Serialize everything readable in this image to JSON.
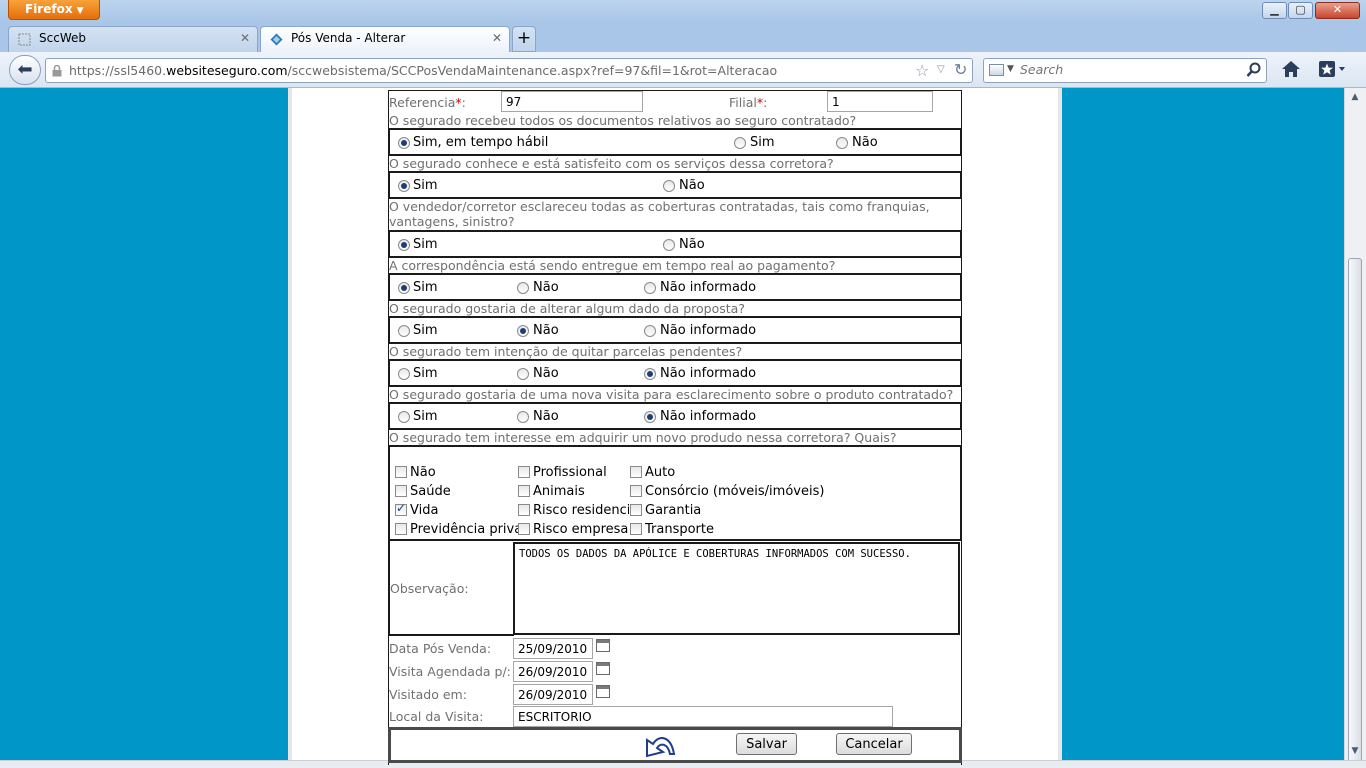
{
  "browser": {
    "app_button_label": "Firefox",
    "tabs": [
      {
        "label": "SccWeb"
      },
      {
        "label": "Pós Venda - Alterar"
      }
    ],
    "new_tab_label": "+",
    "url_prefix": "https://ssl5460.",
    "url_domain": "websiteseguro.com",
    "url_suffix": "/sccwebsistema/SCCPosVendaMaintenance.aspx?ref=97&fil=1&rot=Alteracao",
    "search_placeholder": "Search"
  },
  "form": {
    "referencia_label": "Referencia",
    "referencia_value": "97",
    "filial_label": "Filial",
    "filial_value": "1",
    "required_mark": "*",
    "colon": ":",
    "questions": [
      {
        "text": "O segurado recebeu todos os documentos relativos ao seguro contratado?",
        "options": [
          "Sim, em tempo hábil",
          "Sim",
          "Não"
        ]
      },
      {
        "text": "O segurado conhece e está satisfeito com os serviços dessa corretora?",
        "options": [
          "Sim",
          "Não"
        ]
      },
      {
        "text": "O vendedor/corretor esclareceu todas as coberturas contratadas, tais como franquias, vantagens, sinistro?",
        "options": [
          "Sim",
          "Não"
        ]
      },
      {
        "text": "A correspondência está sendo entregue em tempo real ao pagamento?",
        "options": [
          "Sim",
          "Não",
          "Não informado"
        ]
      },
      {
        "text": "O segurado gostaria de alterar algum dado da proposta?",
        "options": [
          "Sim",
          "Não",
          "Não informado"
        ]
      },
      {
        "text": "O segurado tem intenção de quitar parcelas pendentes?",
        "options": [
          "Sim",
          "Não",
          "Não informado"
        ]
      },
      {
        "text": "O segurado gostaria de uma nova visita para esclarecimento sobre o produto contratado?",
        "options": [
          "Sim",
          "Não",
          "Não informado"
        ]
      }
    ],
    "products_question": "O segurado tem interesse em adquirir um novo produdo nessa corretora? Quais?",
    "products": [
      {
        "label": "Não"
      },
      {
        "label": "Profissional"
      },
      {
        "label": "Auto"
      },
      {
        "label": "Saúde"
      },
      {
        "label": "Animais"
      },
      {
        "label": "Consórcio (móveis/imóveis)"
      },
      {
        "label": "Vida"
      },
      {
        "label": "Risco residencial"
      },
      {
        "label": "Garantia"
      },
      {
        "label": "Previdência privada"
      },
      {
        "label": "Risco empresarial"
      },
      {
        "label": "Transporte"
      }
    ],
    "observacao_label": "Observação:",
    "observacao_value": "TODOS OS DADOS DA APÓLICE E COBERTURAS INFORMADOS COM SUCESSO.",
    "data_pos_venda_label": "Data Pós Venda:",
    "data_pos_venda_value": "25/09/2010",
    "visita_agendada_label": "Visita Agendada p/:",
    "visita_agendada_value": "26/09/2010",
    "visitado_em_label": "Visitado em:",
    "visitado_em_value": "26/09/2010",
    "local_visita_label": "Local da Visita:",
    "local_visita_value": "ESCRITORIO",
    "save_label": "Salvar",
    "cancel_label": "Cancelar"
  },
  "colors": {
    "page_background": "#0096c8",
    "required": "#d40000",
    "label_gray": "#707070"
  },
  "icons": [
    "back-arrow-icon",
    "lock-icon",
    "star-icon",
    "reload-icon",
    "search-icon",
    "home-icon",
    "bookmarks-icon",
    "calendar-icon",
    "back-link-icon"
  ]
}
